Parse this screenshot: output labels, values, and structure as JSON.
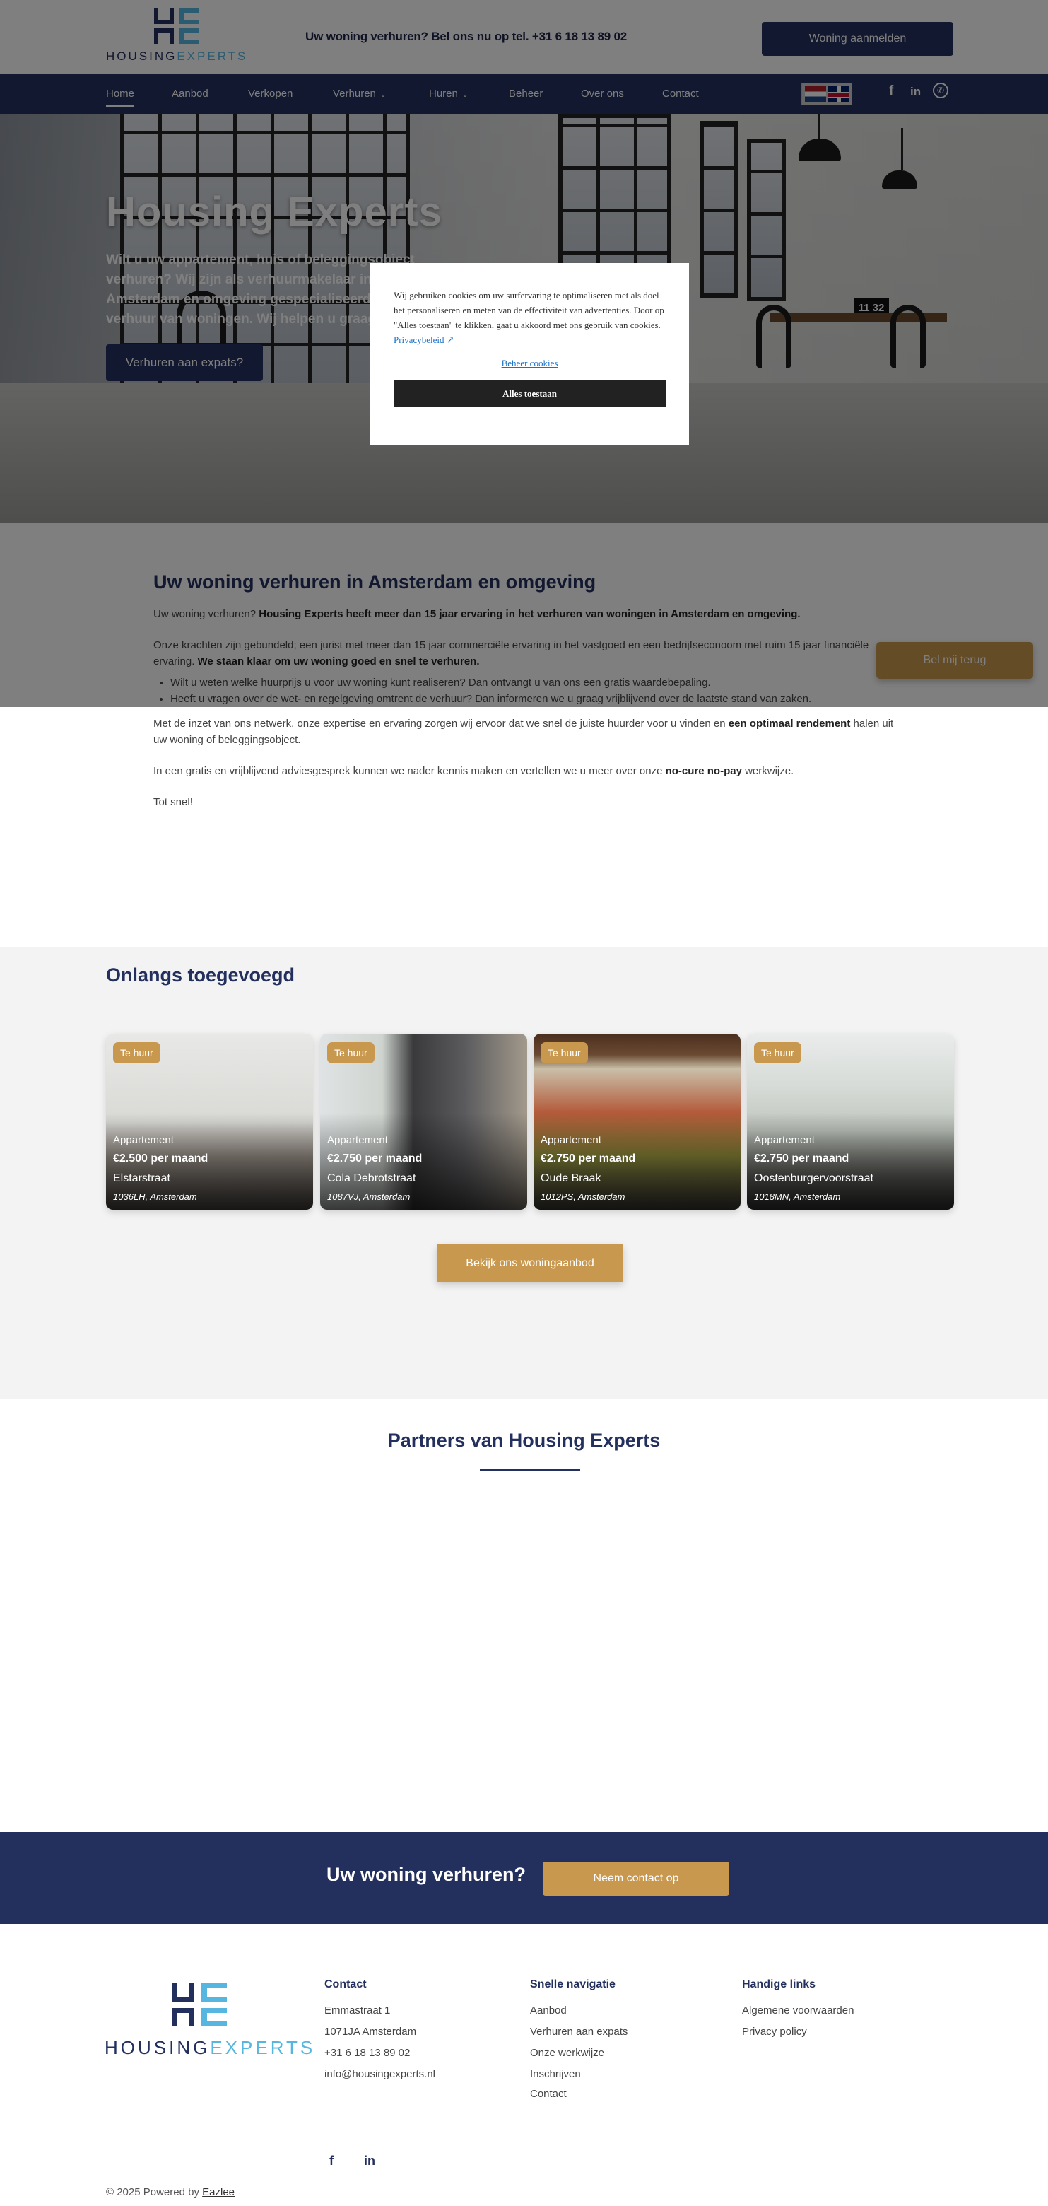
{
  "header": {
    "logo": {
      "part1": "HOUSING",
      "part2": "EXPERTS"
    },
    "phone_line": "Uw woning verhuren? Bel ons nu op tel. +31 6 18 13 89 02",
    "register_button": "Woning aanmelden"
  },
  "nav": {
    "items": [
      {
        "label": "Home",
        "active": true
      },
      {
        "label": "Aanbod"
      },
      {
        "label": "Verkopen"
      },
      {
        "label": "Verhuren",
        "dropdown": true
      },
      {
        "label": "Huren",
        "dropdown": true
      },
      {
        "label": "Beheer"
      },
      {
        "label": "Over ons"
      },
      {
        "label": "Contact"
      }
    ],
    "languages": [
      "nl-flag-icon",
      "uk-flag-icon"
    ],
    "social": [
      "facebook-icon",
      "linkedin-icon",
      "whatsapp-icon"
    ]
  },
  "hero": {
    "title": "Housing Experts",
    "subtitle": "Wilt u uw appartement, huis of beleggingsobject verhuren? Wij zijn als verhuurmakelaar in Amsterdam en omgeving gespecialiseerd in de verhuur van woningen. Wij helpen u graag verder.",
    "button": "Verhuren aan expats?",
    "clock": "11 32"
  },
  "cookie": {
    "text": "Wij gebruiken cookies om uw surfervaring te optimaliseren met als doel het personaliseren en meten van de effectiviteit van advertenties. Door op \"Alles toestaan\" te klikken, gaat u akkoord met ons gebruik van cookies.",
    "privacy_link": "Privacybeleid ↗",
    "manage_link": "Beheer cookies",
    "accept_button": "Alles toestaan"
  },
  "intro": {
    "title": "Uw woning verhuren in Amsterdam en omgeving",
    "p1_plain": "Uw woning verhuren? ",
    "p1_bold": "Housing Experts heeft meer dan 15 jaar ervaring in het verhuren van woningen in Amsterdam en omgeving.",
    "p2_plain": "Onze krachten zijn gebundeld; een jurist met meer dan 15 jaar commerciële ervaring in het vastgoed en een bedrijfseconoom met ruim 15 jaar financiële ervaring. ",
    "p2_bold": "We staan klaar om uw woning goed en snel te verhuren.",
    "bullets": [
      "Wilt u weten welke huurprijs u voor uw woning kunt realiseren? Dan ontvangt u van ons een gratis waardebepaling.",
      "Heeft u vragen over de wet- en regelgeving omtrent de verhuur? Dan informeren we u graag vrijblijvend over de laatste stand van zaken."
    ],
    "p3_plain": "Met de inzet van ons netwerk, onze expertise en ervaring zorgen wij ervoor dat we snel de juiste huurder voor u vinden en ",
    "p3_bold": "een optimaal rendement",
    "p3_end": " halen uit uw woning of beleggingsobject.",
    "p4_plain": "In een gratis en vrijblijvend adviesgesprek kunnen we nader kennis maken en vertellen we u meer over onze ",
    "p4_bold": "no-cure no-pay",
    "p4_end": " werkwijze.",
    "p5": "Tot snel!"
  },
  "callback_button": "Bel mij terug",
  "recent": {
    "title": "Onlangs toegevoegd",
    "listings": [
      {
        "badge": "Te huur",
        "type": "Appartement",
        "price": "€2.500 per maand",
        "street": "Elstarstraat",
        "zip": "1036LH, Amsterdam"
      },
      {
        "badge": "Te huur",
        "type": "Appartement",
        "price": "€2.750 per maand",
        "street": "Cola Debrotstraat",
        "zip": "1087VJ, Amsterdam"
      },
      {
        "badge": "Te huur",
        "type": "Appartement",
        "price": "€2.750 per maand",
        "street": "Oude Braak",
        "zip": "1012PS, Amsterdam"
      },
      {
        "badge": "Te huur",
        "type": "Appartement",
        "price": "€2.750 per maand",
        "street": "Oostenburgervoorstraat",
        "zip": "1018MN, Amsterdam"
      }
    ],
    "button": "Bekijk ons woningaanbod"
  },
  "partners": {
    "title": "Partners van Housing Experts"
  },
  "cta": {
    "text": "Uw woning verhuren?",
    "button": "Neem contact op"
  },
  "footer": {
    "contact": {
      "title": "Contact",
      "lines": [
        "Emmastraat 1",
        "1071JA Amsterdam",
        "+31 6 18 13 89 02",
        "info@housingexperts.nl"
      ]
    },
    "quicknav": {
      "title": "Snelle navigatie",
      "links": [
        "Aanbod",
        "Verhuren aan expats",
        "Onze werkwijze",
        "Inschrijven",
        "Contact"
      ]
    },
    "handy": {
      "title": "Handige links",
      "links": [
        "Algemene voorwaarden",
        "Privacy policy"
      ]
    },
    "copyright": "© 2025  Powered by ",
    "powered_link": "Eazlee"
  },
  "colors": {
    "navy": "#23305e",
    "gold": "#c9984f",
    "light_blue": "#56b6e0",
    "gray_bg": "#f3f3f3"
  }
}
